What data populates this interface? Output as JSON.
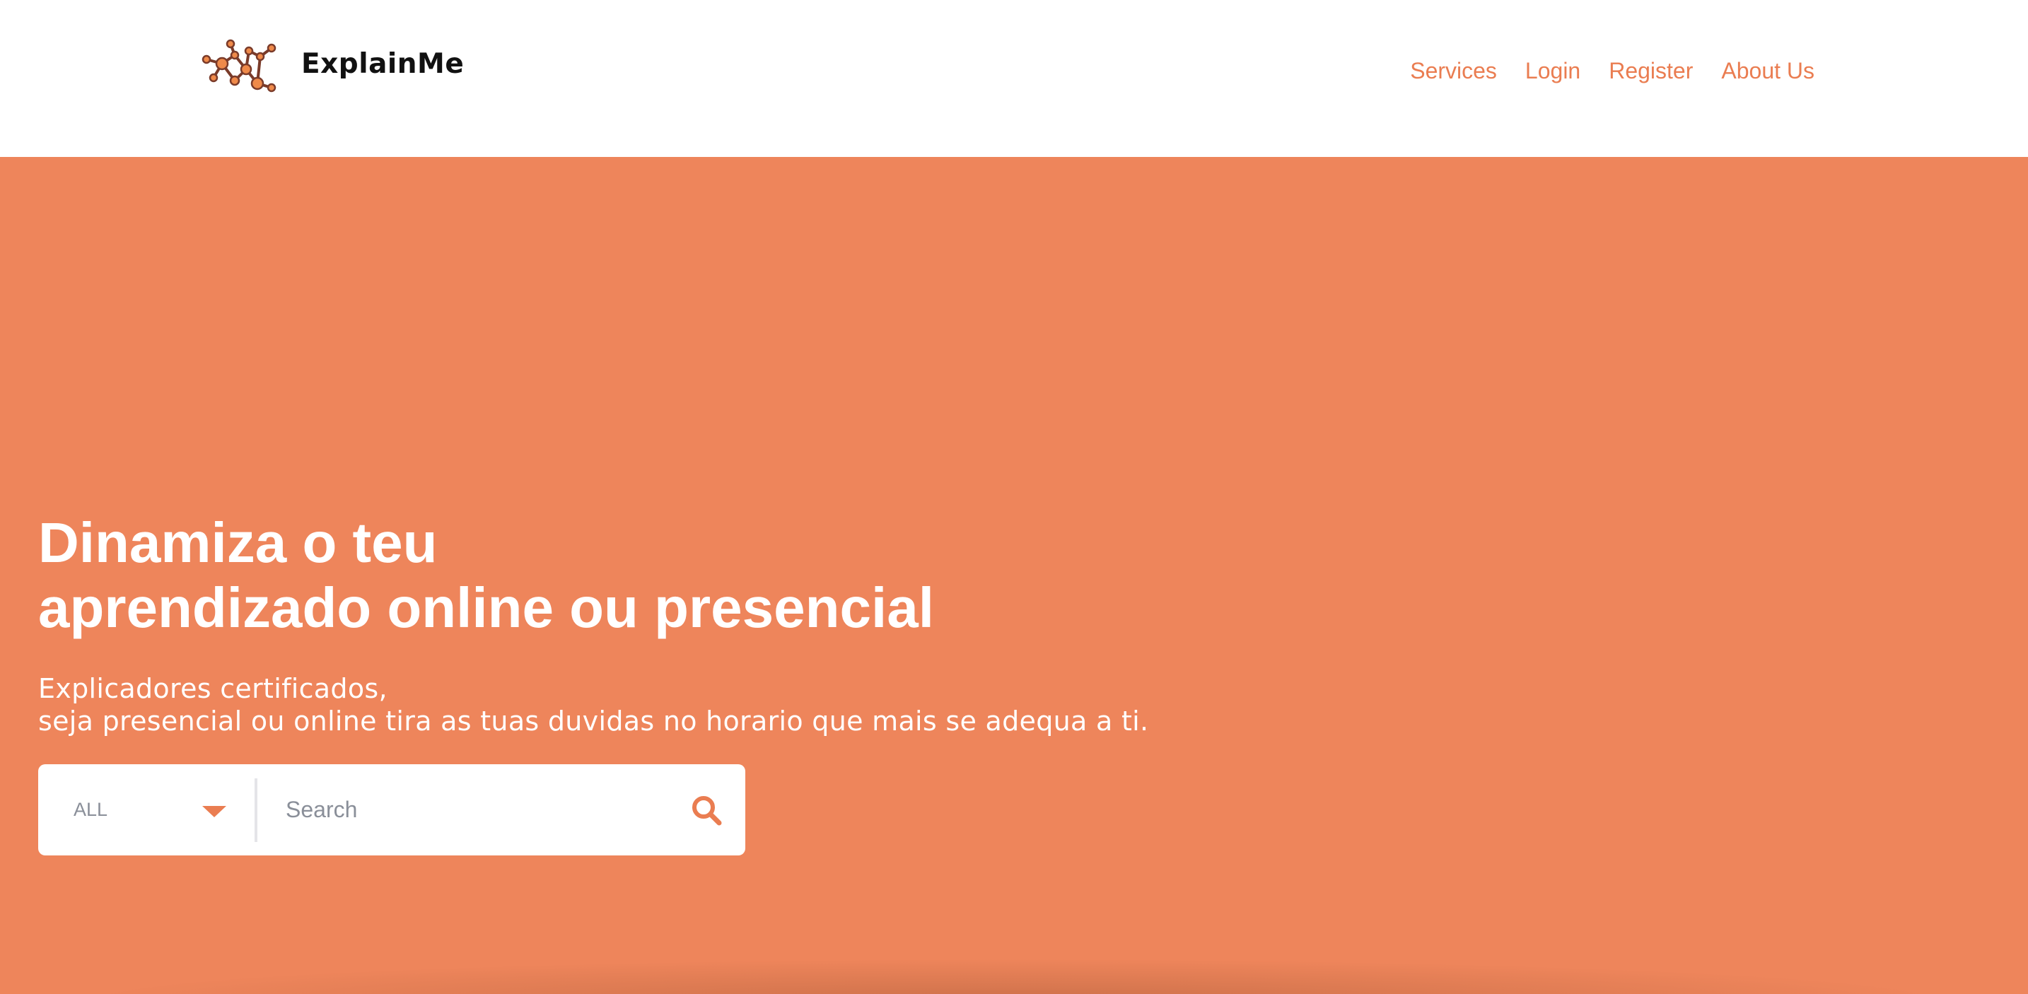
{
  "brand": {
    "name": "ExplainMe",
    "accent_color": "#ee855b",
    "link_color": "#ea7d51"
  },
  "nav": {
    "items": [
      {
        "label": "Services"
      },
      {
        "label": "Login"
      },
      {
        "label": "Register"
      },
      {
        "label": "About Us"
      }
    ]
  },
  "hero": {
    "title_line1": "Dinamiza o teu",
    "title_line2": "aprendizado online ou presencial",
    "subtitle_line1": "Explicadores certificados,",
    "subtitle_line2": "seja presencial ou online tira as tuas duvidas no horario que mais se adequa a ti."
  },
  "search": {
    "category_selected": "ALL",
    "placeholder": "Search",
    "value": "",
    "icon": "search-icon",
    "caret_icon": "caret-down-icon"
  }
}
